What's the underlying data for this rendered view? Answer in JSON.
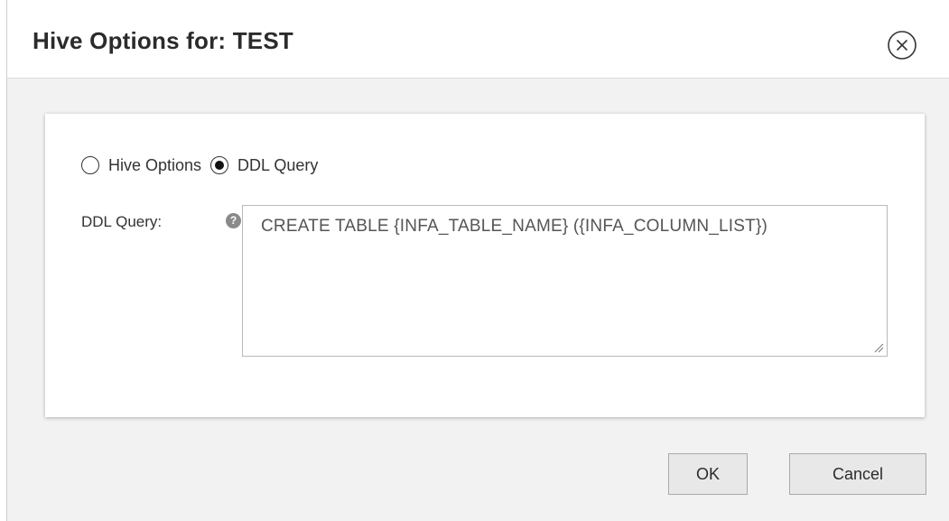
{
  "dialog": {
    "title": "Hive Options for: TEST",
    "close_icon": "close-circle-icon"
  },
  "options": {
    "radio_hive_options_label": "Hive Options",
    "radio_ddl_query_label": "DDL Query",
    "selected": "DDL Query"
  },
  "ddl_field": {
    "label": "DDL Query:",
    "help_icon": "help-icon",
    "help_glyph": "?",
    "value": "CREATE  TABLE {INFA_TABLE_NAME} ({INFA_COLUMN_LIST})"
  },
  "footer": {
    "ok_label": "OK",
    "cancel_label": "Cancel"
  }
}
